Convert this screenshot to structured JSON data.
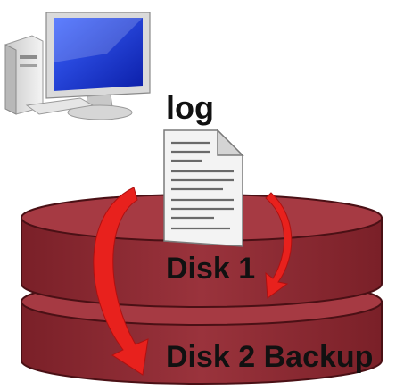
{
  "diagram": {
    "log_label": "log",
    "disk1_label": "Disk 1",
    "disk2_label": "Disk 2 Backup"
  },
  "icons": {
    "computer": "computer-icon",
    "document": "log-document-icon",
    "arrow": "red-curved-arrow"
  },
  "colors": {
    "disk_fill": "#8e2a33",
    "disk_top": "#a63a43",
    "arrow": "#e8211d",
    "monitor_screen": "#1c38d6"
  }
}
